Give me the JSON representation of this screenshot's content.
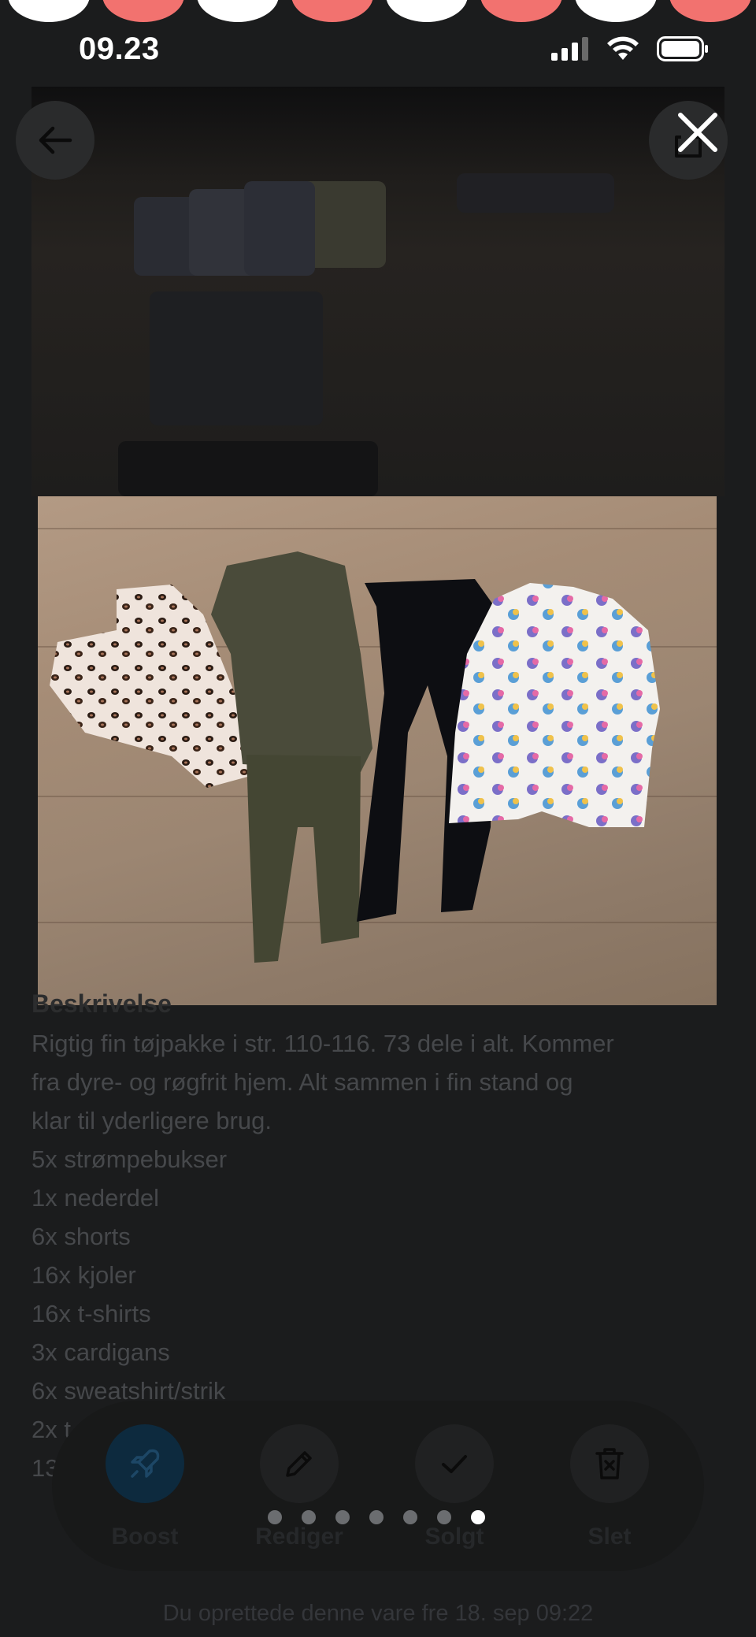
{
  "status_bar": {
    "time": "09.23",
    "signal_icon": "signal-bars-icon",
    "wifi_icon": "wifi-icon",
    "battery_icon": "battery-icon"
  },
  "nav": {
    "back_icon": "arrow-left-icon",
    "share_icon": "share-icon",
    "close_icon": "close-icon"
  },
  "description": {
    "heading": "Beskrivelse",
    "lines": [
      "Rigtig fin tøjpakke i str. 110-116. 73 dele i alt. Kommer",
      "fra dyre- og røgfrit hjem. Alt sammen i fin stand og",
      "klar til yderligere brug.",
      "5x strømpebukser",
      "1x nederdel",
      "6x shorts",
      "16x kjoler",
      "16x t-shirts",
      "3x cardigans",
      "6x sweatshirt/strik",
      "2x t",
      "13"
    ]
  },
  "actions": [
    {
      "label": "Boost",
      "icon": "rocket-icon"
    },
    {
      "label": "Rediger",
      "icon": "pencil-icon"
    },
    {
      "label": "Solgt",
      "icon": "checkmark-icon"
    },
    {
      "label": "Slet",
      "icon": "trash-icon"
    }
  ],
  "gallery": {
    "total_images": 7,
    "current_index": 7
  },
  "footer": {
    "created_note": "Du oprettede denne vare fre 18. sep 09:22"
  },
  "colors": {
    "background": "#1b1c1d",
    "accent_pink": "#f2726f",
    "boost_blue": "#0d2a3e"
  }
}
